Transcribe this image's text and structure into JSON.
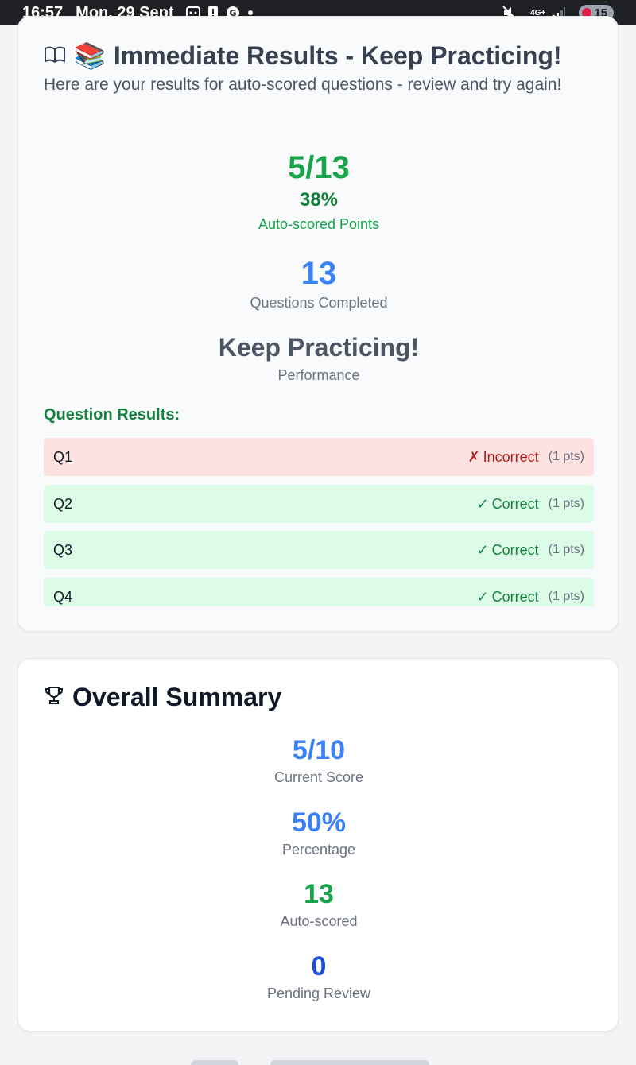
{
  "status_bar": {
    "time": "16:57",
    "date": "Mon, 29 Sept",
    "network": "4G+",
    "battery": "15"
  },
  "results": {
    "title": "Immediate Results - Keep Practicing!",
    "title_emoji": "📚",
    "subtitle": "Here are your results for auto-scored questions - review and try again!",
    "points_value": "5/13",
    "points_percent": "38%",
    "points_label": "Auto-scored Points",
    "completed_value": "13",
    "completed_label": "Questions Completed",
    "performance_value": "Keep Practicing!",
    "performance_label": "Performance",
    "questions_heading": "Question Results:",
    "questions": [
      {
        "label": "Q1",
        "mark": "✗",
        "status": "Incorrect",
        "pts": "(1 pts)",
        "result": "incorrect"
      },
      {
        "label": "Q2",
        "mark": "✓",
        "status": "Correct",
        "pts": "(1 pts)",
        "result": "correct"
      },
      {
        "label": "Q3",
        "mark": "✓",
        "status": "Correct",
        "pts": "(1 pts)",
        "result": "correct"
      },
      {
        "label": "Q4",
        "mark": "✓",
        "status": "Correct",
        "pts": "(1 pts)",
        "result": "correct"
      }
    ]
  },
  "summary": {
    "title": "Overall Summary",
    "current_score_value": "5/10",
    "current_score_label": "Current Score",
    "percentage_value": "50%",
    "percentage_label": "Percentage",
    "auto_scored_value": "13",
    "auto_scored_label": "Auto-scored",
    "pending_value": "0",
    "pending_label": "Pending Review"
  },
  "colors": {
    "correct_bg": "#dcfce7",
    "incorrect_bg": "#fee2e2",
    "green": "#16a34a",
    "blue": "#3b82f6",
    "red": "#b91c1c"
  }
}
